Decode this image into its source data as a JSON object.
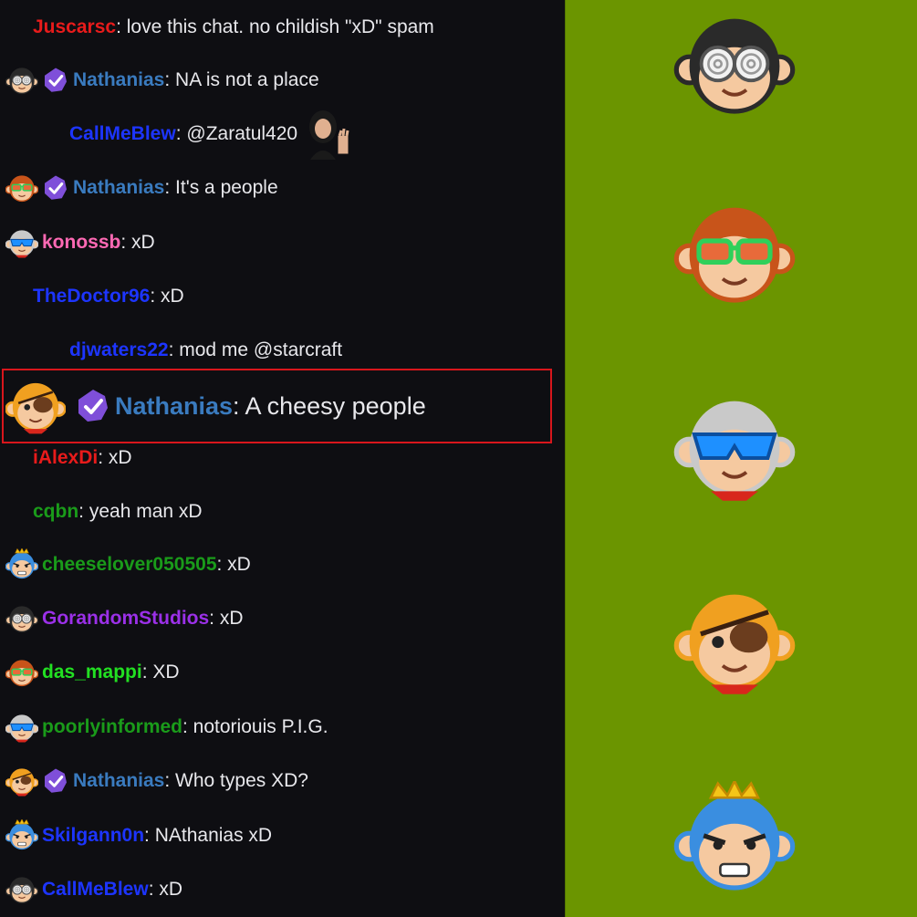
{
  "chat": {
    "messages": [
      {
        "user": "Juscarsc",
        "color": "#e81b1b",
        "text": ": love this chat. no childish \"xD\" spam",
        "avatar": "",
        "badge": false
      },
      {
        "user": "Nathanias",
        "color": "#3a7bbf",
        "text": ": NA is not a place",
        "avatar": "goggles-monkey",
        "badge": true
      },
      {
        "user": "CallMeBlew",
        "color": "#1d35ff",
        "text": ": @Zaratul420",
        "avatar": "",
        "badge": false,
        "emote": "waving-woman-emote"
      },
      {
        "user": "Nathanias",
        "color": "#3a7bbf",
        "text": ": It's a people",
        "avatar": "green-shades-monkey",
        "badge": true
      },
      {
        "user": "konossb",
        "color": "#ff69b4",
        "text": ": xD",
        "avatar": "blue-shades-monkey",
        "badge": false
      },
      {
        "user": "TheDoctor96",
        "color": "#1d35ff",
        "text": ": xD",
        "avatar": "",
        "badge": false
      },
      {
        "user": "djwaters22",
        "color": "#1d35ff",
        "text": ": mod me @starcraft",
        "avatar": "",
        "badge": false
      },
      {
        "user": "iAlexDi",
        "color": "#e81b1b",
        "text": ": xD",
        "avatar": "",
        "badge": false
      },
      {
        "user": "cqbn",
        "color": "#1a9b1a",
        "text": ": yeah man xD",
        "avatar": "",
        "badge": false
      },
      {
        "user": "cheeselover050505",
        "color": "#1a9b1a",
        "text": ": xD",
        "avatar": "king-monkey",
        "badge": false
      },
      {
        "user": "GorandomStudios",
        "color": "#9b30e8",
        "text": ": xD",
        "avatar": "goggles-monkey",
        "badge": false
      },
      {
        "user": "das_mappi",
        "color": "#22e022",
        "text": ": XD",
        "avatar": "green-shades-monkey",
        "badge": false
      },
      {
        "user": "poorlyinformed",
        "color": "#1a9b1a",
        "text": ": notoriouis P.I.G.",
        "avatar": "blue-shades-monkey",
        "badge": false
      },
      {
        "user": "Nathanias",
        "color": "#3a7bbf",
        "text": ": Who types XD?",
        "avatar": "pirate-monkey",
        "badge": true
      },
      {
        "user": "Skilgann0n",
        "color": "#1d35ff",
        "text": ": NAthanias xD",
        "avatar": "king-monkey",
        "badge": false
      },
      {
        "user": "CallMeBlew",
        "color": "#1d35ff",
        "text": ": xD",
        "avatar": "goggles-monkey",
        "badge": false
      }
    ],
    "highlight": {
      "user": "Nathanias",
      "color": "#3a7bbf",
      "text": ": A cheesy people",
      "avatar": "pirate-monkey",
      "badge": true
    }
  },
  "sidebar": {
    "emotes": [
      "goggles-monkey",
      "green-shades-monkey",
      "blue-shades-monkey",
      "pirate-monkey",
      "king-monkey"
    ]
  },
  "colors": {
    "chat_bg": "#0e0e12",
    "sidebar_bg": "#6b9500",
    "highlight_border": "#d8161c",
    "badge_purple": "#7f4fd9"
  }
}
